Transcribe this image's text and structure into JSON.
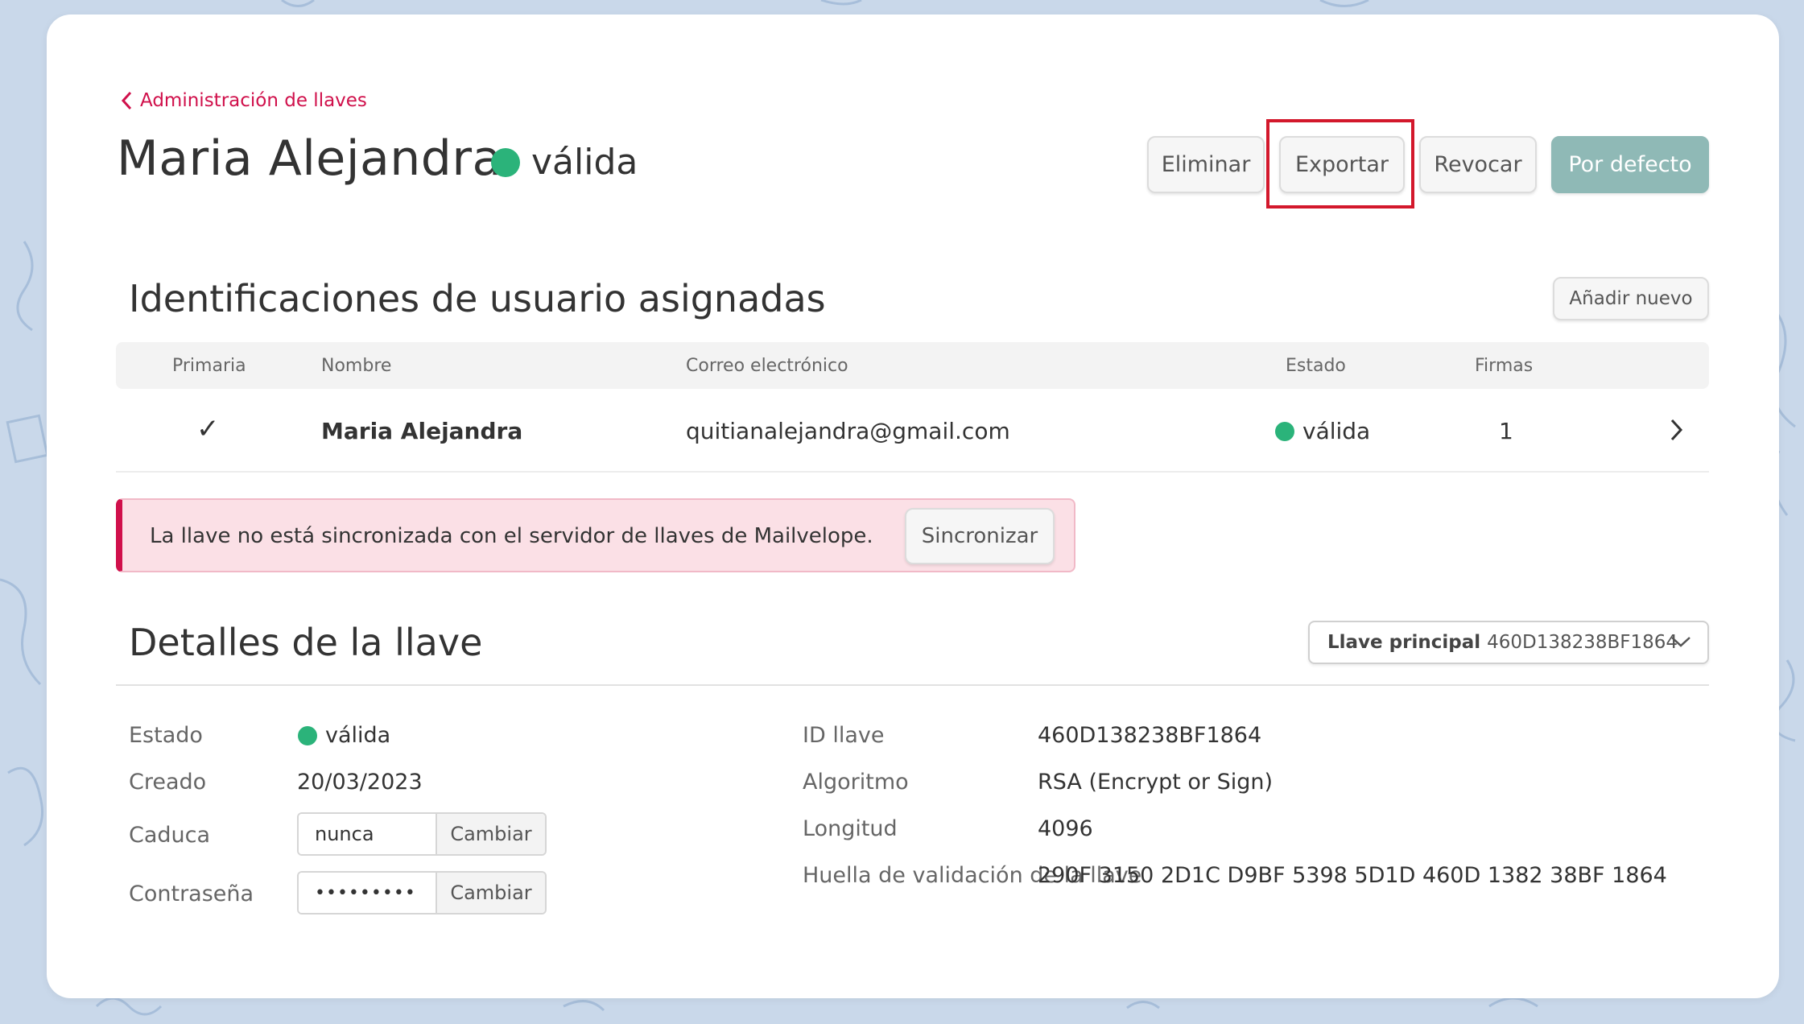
{
  "breadcrumb": {
    "label": "Administración de llaves"
  },
  "header": {
    "title": "Maria Alejandra",
    "status": "válida",
    "status_color": "#2bb37a",
    "buttons": {
      "delete": "Eliminar",
      "export": "Exportar",
      "revoke": "Revocar",
      "default": "Por defecto"
    }
  },
  "user_ids": {
    "heading": "Identificaciones de usuario asignadas",
    "add_button": "Añadir nuevo",
    "columns": [
      "Primaria",
      "Nombre",
      "Correo electrónico",
      "Estado",
      "Firmas"
    ],
    "rows": [
      {
        "primary": "✓",
        "name": "Maria Alejandra",
        "email": "quitianalejandra@gmail.com",
        "status": "válida",
        "signatures": "1"
      }
    ]
  },
  "alert": {
    "message": "La llave no está sincronizada con el servidor de llaves de Mailvelope.",
    "button": "Sincronizar",
    "accent_color": "#d0104b"
  },
  "key_details": {
    "heading": "Detalles de la llave",
    "selector": {
      "label": "Llave principal",
      "value": "460D138238BF1864"
    },
    "left": {
      "status_label": "Estado",
      "status_value": "válida",
      "created_label": "Creado",
      "created_value": "20/03/2023",
      "expires_label": "Caduca",
      "expires_value": "nunca",
      "expires_button": "Cambiar",
      "password_label": "Contraseña",
      "password_value": "•••••••••",
      "password_button": "Cambiar"
    },
    "right": {
      "keyid_label": "ID llave",
      "keyid_value": "460D138238BF1864",
      "algorithm_label": "Algoritmo",
      "algorithm_value": "RSA (Encrypt or Sign)",
      "length_label": "Longitud",
      "length_value": "4096",
      "fingerprint_label": "Huella de validación de la llave",
      "fingerprint_value": "290F 3150 2D1C D9BF 5398 5D1D 460D 1382 38BF 1864"
    }
  }
}
